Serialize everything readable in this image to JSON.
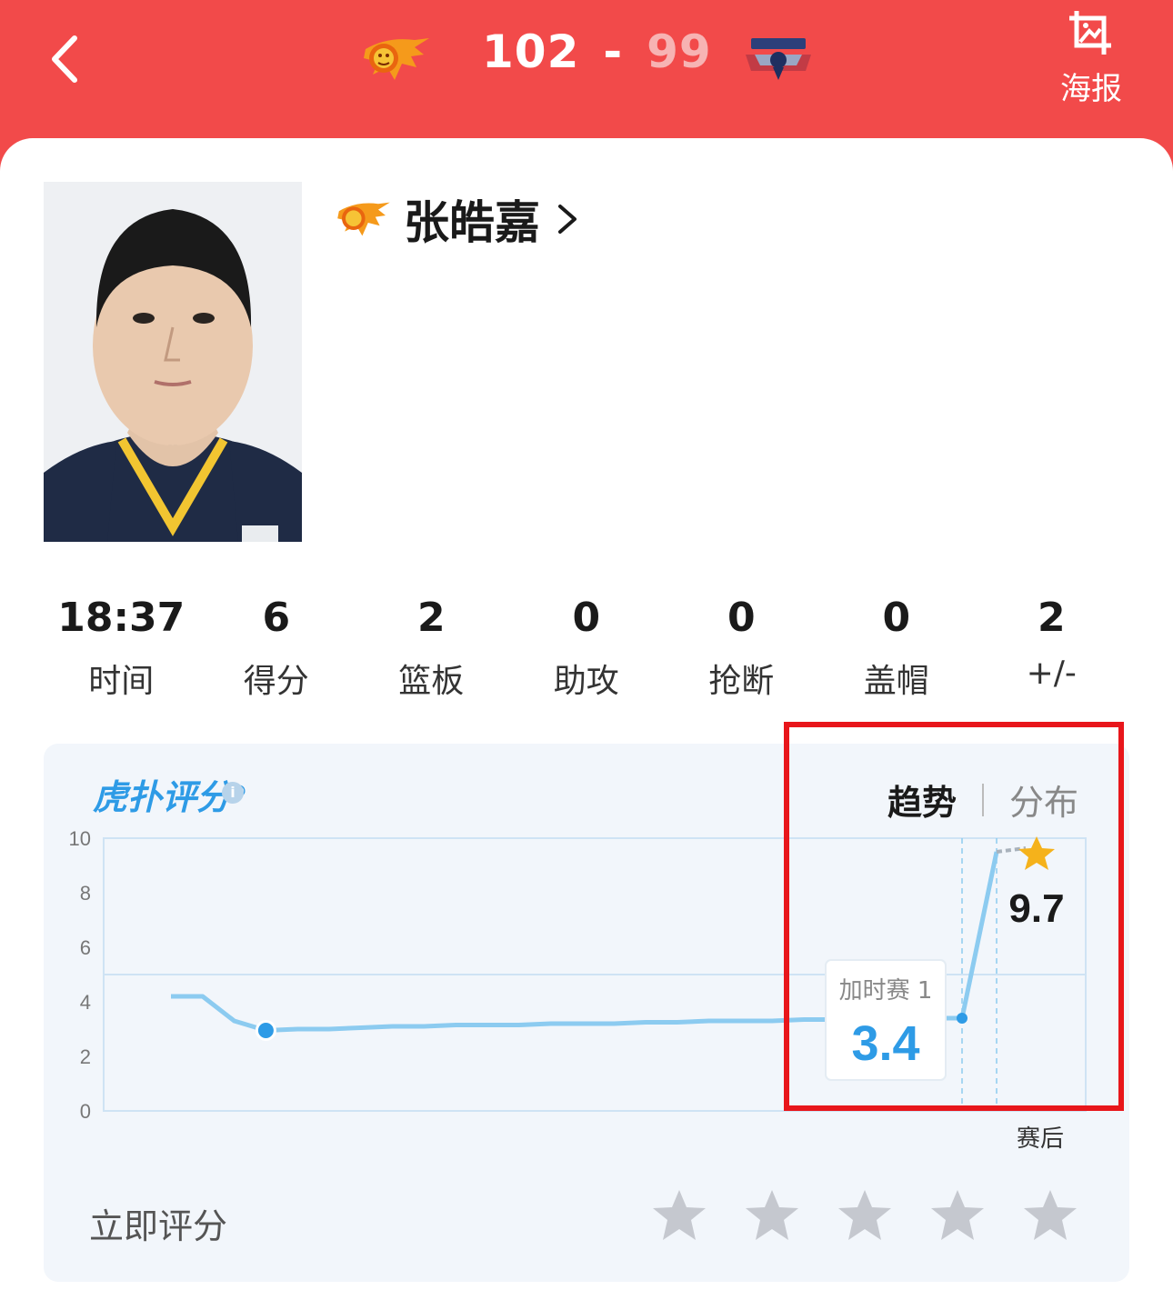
{
  "header": {
    "home_score": "102",
    "separator": "-",
    "away_score": "99",
    "poster_label": "海报",
    "colors": {
      "bg": "#f24a4a",
      "away_score": "#f7b3b3"
    }
  },
  "player": {
    "name": "张皓嘉"
  },
  "stats": [
    {
      "value": "18:37",
      "label": "时间"
    },
    {
      "value": "6",
      "label": "得分"
    },
    {
      "value": "2",
      "label": "篮板"
    },
    {
      "value": "0",
      "label": "助攻"
    },
    {
      "value": "0",
      "label": "抢断"
    },
    {
      "value": "0",
      "label": "盖帽"
    },
    {
      "value": "2",
      "label": "+/-"
    }
  ],
  "rating": {
    "brand": "虎扑评分",
    "registered": "®",
    "tabs": {
      "trend": "趋势",
      "distribution": "分布"
    },
    "rate_now": "立即评分",
    "stars_count": 5
  },
  "chart_data": {
    "type": "line",
    "ylim": [
      0,
      10
    ],
    "yticks": [
      "0",
      "2",
      "4",
      "6",
      "8",
      "10"
    ],
    "reference_line": 5,
    "x": [
      1,
      2,
      3,
      4,
      5,
      6,
      7,
      8,
      9,
      10,
      11,
      12,
      13,
      14,
      15,
      16,
      17,
      18,
      19,
      20,
      21,
      22,
      23,
      24,
      25,
      26,
      27
    ],
    "values": [
      4.2,
      4.2,
      3.3,
      2.95,
      3.0,
      3.0,
      3.05,
      3.1,
      3.1,
      3.15,
      3.15,
      3.15,
      3.2,
      3.2,
      3.2,
      3.25,
      3.25,
      3.3,
      3.3,
      3.3,
      3.35,
      3.35,
      3.35,
      3.4,
      3.4,
      3.4,
      9.5
    ],
    "highlight_point": {
      "x": 4,
      "y": 2.95
    },
    "tooltip": {
      "label": "加时赛 1",
      "value": "3.4"
    },
    "final": {
      "value": "9.7",
      "label": "赛后"
    },
    "colors": {
      "line": "#8ccbf0",
      "point": "#2e9be6",
      "grid": "#cfe3f4",
      "star": "#f5b21b"
    }
  }
}
